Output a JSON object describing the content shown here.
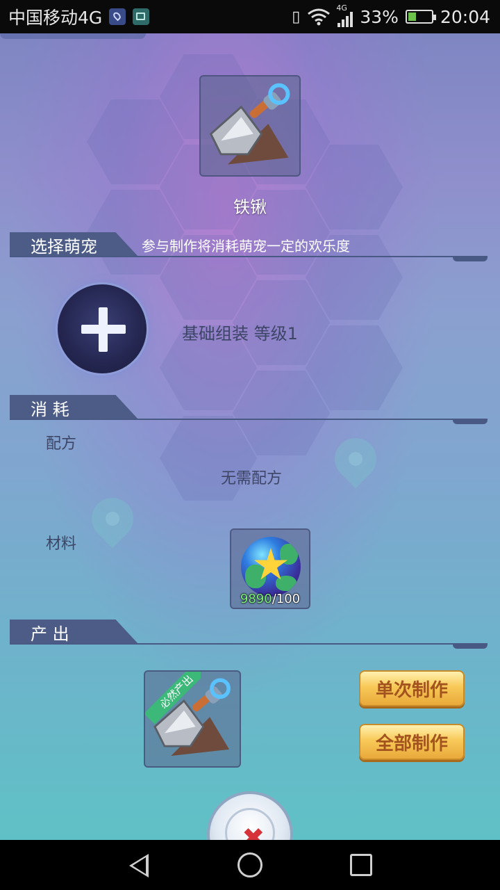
{
  "status_bar": {
    "carrier": "中国移动4G",
    "network": "4G",
    "battery": "33%",
    "battery_level": 0.33,
    "time": "20:04"
  },
  "item": {
    "name": "铁锹",
    "icon": "iron-shovel-icon"
  },
  "pet_section": {
    "title": "选择萌宠",
    "hint": "参与制作将消耗萌宠一定的欢乐度",
    "add_icon": "plus-icon",
    "craft_level": "基础组装 等级1"
  },
  "consume_section": {
    "title": "消 耗",
    "recipe_label": "配方",
    "recipe_value": "无需配方",
    "material_label": "材料",
    "material_icon": "star-orb-icon",
    "material_have": "9890",
    "material_need": "/100"
  },
  "output_section": {
    "title": "产 出",
    "ribbon": "必然产出",
    "output_icon": "iron-shovel-icon"
  },
  "buttons": {
    "single": "单次制作",
    "all": "全部制作",
    "close_icon": "close-icon"
  },
  "colors": {
    "section_tab": "#4d5c87",
    "gold_button": "#f8c958",
    "ribbon": "#3cb879",
    "material_have": "#7cf27c"
  }
}
